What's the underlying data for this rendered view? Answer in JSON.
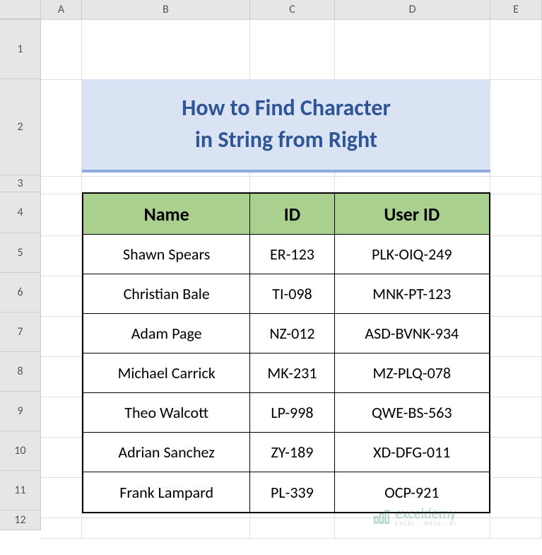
{
  "columns": {
    "A": "A",
    "B": "B",
    "C": "C",
    "D": "D",
    "E": "E"
  },
  "rows": {
    "r1": "1",
    "r2": "2",
    "r3": "3",
    "r4": "4",
    "r5": "5",
    "r6": "6",
    "r7": "7",
    "r8": "8",
    "r9": "9",
    "r10": "10",
    "r11": "11",
    "r12": "12"
  },
  "title": {
    "line1": "How to Find Character",
    "line2": "in String from Right"
  },
  "headers": {
    "name": "Name",
    "id": "ID",
    "userid": "User ID"
  },
  "data": [
    {
      "name": "Shawn Spears",
      "id": "ER-123",
      "userid": "PLK-OIQ-249"
    },
    {
      "name": "Christian Bale",
      "id": "TI-098",
      "userid": "MNK-PT-123"
    },
    {
      "name": "Adam Page",
      "id": "NZ-012",
      "userid": "ASD-BVNK-934"
    },
    {
      "name": "Michael Carrick",
      "id": "MK-231",
      "userid": "MZ-PLQ-078"
    },
    {
      "name": "Theo Walcott",
      "id": "LP-998",
      "userid": "QWE-BS-563"
    },
    {
      "name": "Adrian Sanchez",
      "id": "ZY-189",
      "userid": "XD-DFG-011"
    },
    {
      "name": "Frank Lampard",
      "id": "PL-339",
      "userid": "OCP-921"
    }
  ],
  "watermark": {
    "main": "exceldemy",
    "sub": "EXCEL · DATA · BI"
  }
}
